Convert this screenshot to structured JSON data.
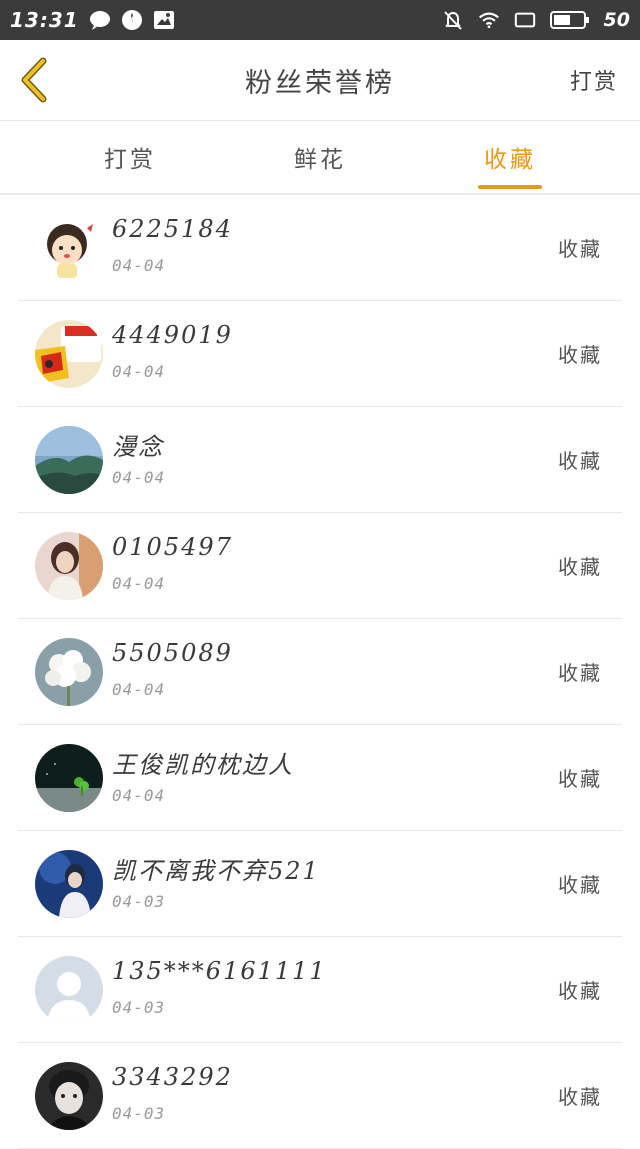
{
  "status_bar": {
    "time": "13:31",
    "battery": "50",
    "icons_left": [
      "chat-bubble-icon",
      "shield-app-icon",
      "image-app-icon"
    ],
    "icons_right": [
      "mute-bell-icon",
      "wifi-icon",
      "screen-frame-icon",
      "battery-icon"
    ]
  },
  "header": {
    "back_icon": "chevron-left-icon",
    "title": "粉丝荣誉榜",
    "action": "打赏",
    "accent_color": "#e99818"
  },
  "tabs": [
    {
      "label": "打赏",
      "active": false
    },
    {
      "label": "鲜花",
      "active": false
    },
    {
      "label": "收藏",
      "active": true
    }
  ],
  "list": [
    {
      "name": "6225184",
      "date": "04-04",
      "action": "收藏"
    },
    {
      "name": "4449019",
      "date": "04-04",
      "action": "收藏"
    },
    {
      "name": "漫念",
      "date": "04-04",
      "action": "收藏"
    },
    {
      "name": "0105497",
      "date": "04-04",
      "action": "收藏"
    },
    {
      "name": "5505089",
      "date": "04-04",
      "action": "收藏"
    },
    {
      "name": "王俊凯的枕边人",
      "date": "04-04",
      "action": "收藏"
    },
    {
      "name": "凯不离我不弃521",
      "date": "04-03",
      "action": "收藏"
    },
    {
      "name": "135***6161111",
      "date": "04-03",
      "action": "收藏"
    },
    {
      "name": "3343292",
      "date": "04-03",
      "action": "收藏"
    }
  ]
}
